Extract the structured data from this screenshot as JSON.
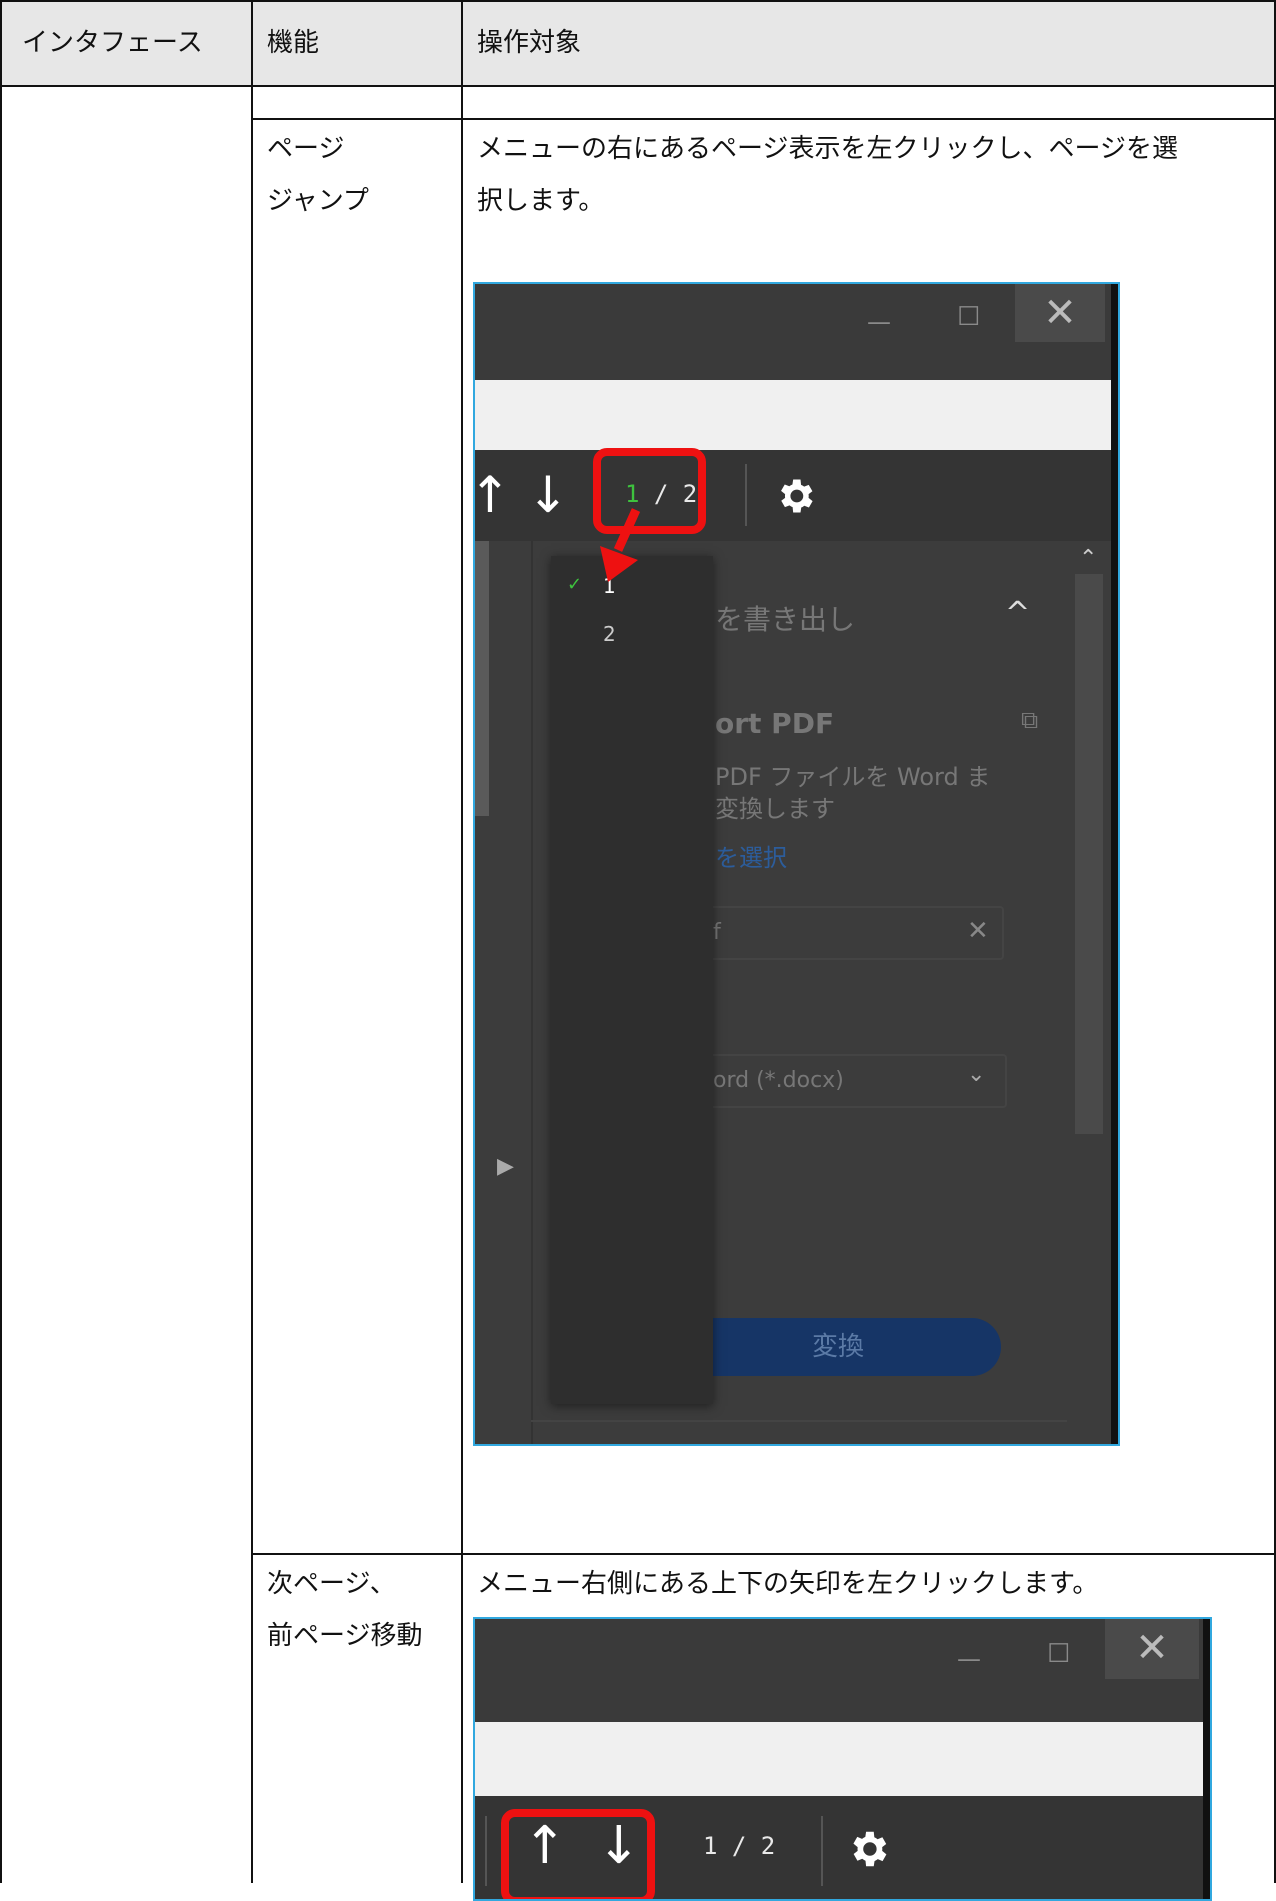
{
  "table": {
    "headers": [
      "インタフェース",
      "機能",
      "操作対象"
    ],
    "rows": [
      {
        "function_lines": [
          "ページ",
          "ジャンプ"
        ],
        "description_lines": [
          "メニューの右にあるページ表示を左クリックし、ページを選",
          "択します。"
        ]
      },
      {
        "function_lines": [
          "次ページ、",
          "前ページ移動"
        ],
        "description_lines": [
          "メニュー右側にある上下の矢印を左クリックします。"
        ]
      }
    ]
  },
  "shot1": {
    "window_controls": {
      "minimize": "—",
      "maximize": "☐",
      "close": "✕"
    },
    "toolbar": {
      "up_arrow": "↑",
      "down_arrow": "↓",
      "current_page": "1",
      "separator": " / 2",
      "gear": "gear-icon"
    },
    "dropdown": {
      "items": [
        {
          "check": "✓",
          "label": "1"
        },
        {
          "check": "",
          "label": "2"
        }
      ]
    },
    "panel": {
      "section_title": "を書き出し",
      "chevron_up": "^",
      "export_title": "ort PDF",
      "desc_line1": "PDF ファイルを Word ま",
      "desc_line2": "変換します",
      "select_link": "を選択",
      "file_field_value": "f",
      "clear_icon": "✕",
      "format_select": "ord (*.docx)",
      "convert_button": "変換"
    }
  },
  "shot2": {
    "window_controls": {
      "minimize": "—",
      "maximize": "☐",
      "close": "✕"
    },
    "toolbar": {
      "up_arrow": "↑",
      "down_arrow": "↓",
      "page_indicator": "1 / 2",
      "gear": "gear-icon"
    }
  },
  "colors": {
    "highlight": "#ee1111",
    "accent_green": "#3ec23e",
    "frame": "#31a8df"
  }
}
